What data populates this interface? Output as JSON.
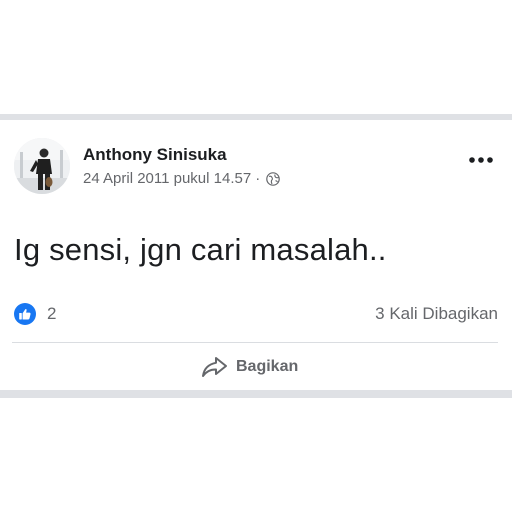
{
  "post": {
    "author": {
      "name": "Anthony Sinisuka",
      "avatar_icon": "profile-photo"
    },
    "timestamp": "24 April 2011 pukul 14.57",
    "meta_separator": "·",
    "privacy_icon": "globe-icon",
    "more_icon": "more-options-icon",
    "text": "Ig sensi, jgn cari masalah..",
    "reactions": {
      "icon": "like-icon",
      "count": "2"
    },
    "shares": {
      "label": "3 Kali Dibagikan"
    },
    "actions": {
      "share_label": "Bagikan",
      "share_icon": "share-arrow-icon"
    }
  },
  "colors": {
    "text_primary": "#1c1e21",
    "text_secondary": "#65676b",
    "like_blue": "#1877f2",
    "frame_gray": "#dfe1e5",
    "divider": "#dadde1"
  }
}
